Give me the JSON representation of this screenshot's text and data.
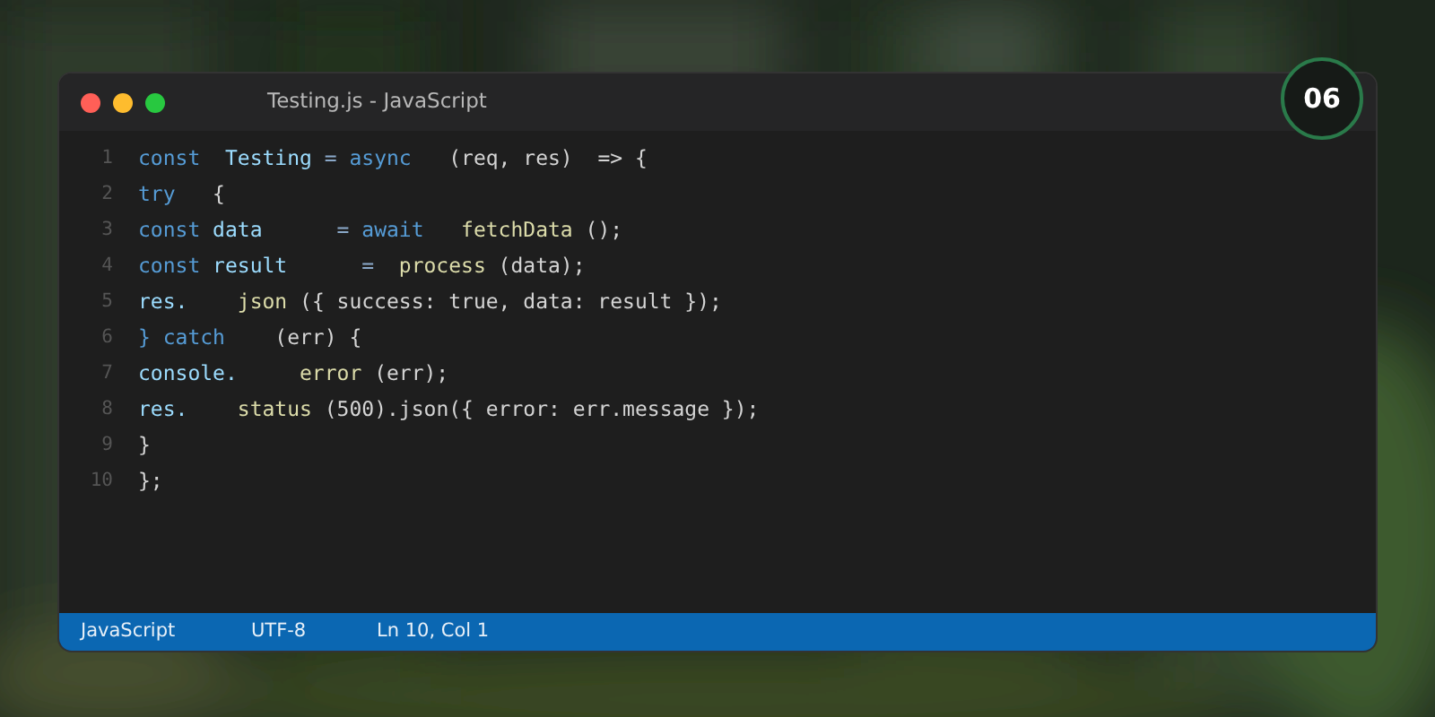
{
  "window": {
    "title": "Testing.js - JavaScript",
    "badge": "06"
  },
  "code_lines": [
    {
      "number": "1",
      "tokens": [
        {
          "kind": "keyword",
          "text": "const"
        },
        {
          "kind": "ident",
          "text": "  Testing"
        },
        {
          "kind": "op",
          "text": " = "
        },
        {
          "kind": "keyword",
          "text": "async"
        },
        {
          "kind": "plain",
          "text": "   (req, res)  => {"
        }
      ]
    },
    {
      "number": "2",
      "tokens": [
        {
          "kind": "keyword",
          "text": "try"
        },
        {
          "kind": "plain",
          "text": "   {"
        }
      ]
    },
    {
      "number": "3",
      "tokens": [
        {
          "kind": "keyword",
          "text": "const"
        },
        {
          "kind": "ident",
          "text": " data"
        },
        {
          "kind": "op",
          "text": "      = "
        },
        {
          "kind": "keyword",
          "text": "await"
        },
        {
          "kind": "func",
          "text": "   fetchData"
        },
        {
          "kind": "plain",
          "text": " ();"
        }
      ]
    },
    {
      "number": "4",
      "tokens": [
        {
          "kind": "keyword",
          "text": "const"
        },
        {
          "kind": "ident",
          "text": " result"
        },
        {
          "kind": "op",
          "text": "      =  "
        },
        {
          "kind": "func",
          "text": "process"
        },
        {
          "kind": "plain",
          "text": " (data);"
        }
      ]
    },
    {
      "number": "5",
      "tokens": [
        {
          "kind": "ident",
          "text": "res."
        },
        {
          "kind": "func",
          "text": "    json"
        },
        {
          "kind": "plain",
          "text": " ({ success: true, data: result });"
        }
      ]
    },
    {
      "number": "6",
      "tokens": [
        {
          "kind": "keyword",
          "text": "} catch"
        },
        {
          "kind": "plain",
          "text": "    (err) {"
        }
      ]
    },
    {
      "number": "7",
      "tokens": [
        {
          "kind": "ident",
          "text": "console."
        },
        {
          "kind": "func",
          "text": "     error"
        },
        {
          "kind": "plain",
          "text": " (err);"
        }
      ]
    },
    {
      "number": "8",
      "tokens": [
        {
          "kind": "ident",
          "text": "res."
        },
        {
          "kind": "func",
          "text": "    status"
        },
        {
          "kind": "plain",
          "text": " (500).json({ error: err.message });"
        }
      ]
    },
    {
      "number": "9",
      "tokens": [
        {
          "kind": "plain",
          "text": "}"
        }
      ]
    },
    {
      "number": "10",
      "tokens": [
        {
          "kind": "plain",
          "text": "};"
        }
      ]
    }
  ],
  "status_bar": [
    "JavaScript",
    "UTF-8",
    "Ln 10, Col 1"
  ]
}
